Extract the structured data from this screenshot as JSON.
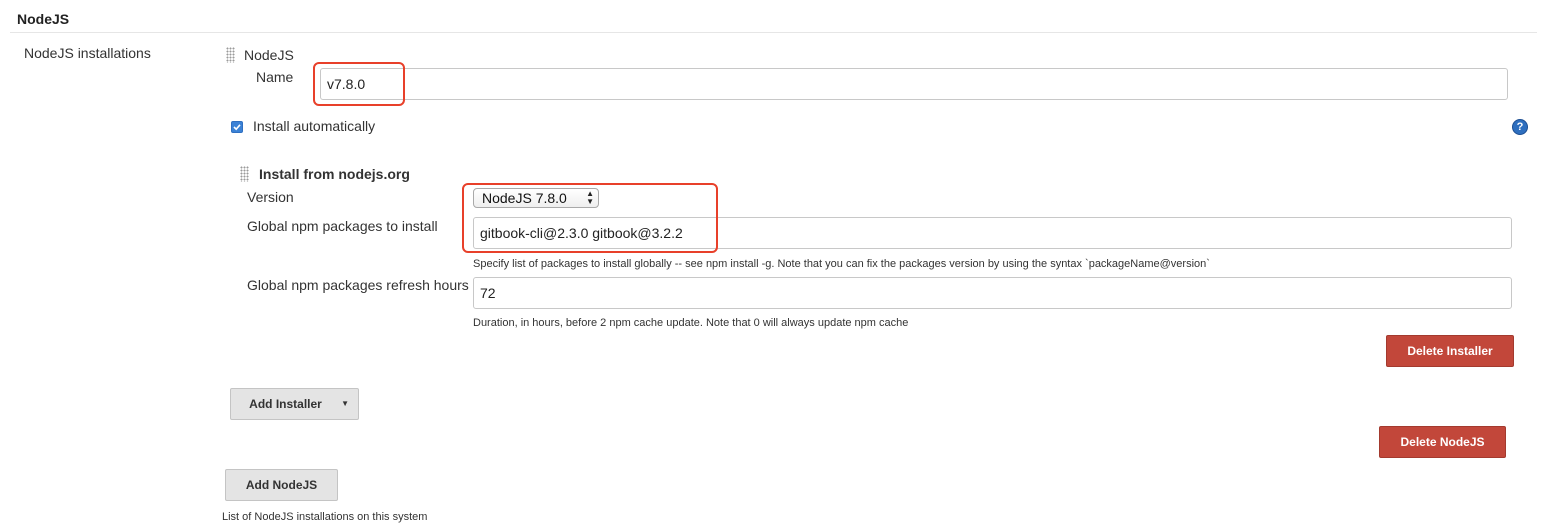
{
  "section": {
    "title": "NodeJS",
    "installations_label": "NodeJS installations"
  },
  "nodejs": {
    "header": "NodeJS",
    "name_label": "Name",
    "name_value": "v7.8.0",
    "install_automatically_label": "Install automatically",
    "install_automatically_checked": true
  },
  "installer": {
    "header": "Install from nodejs.org",
    "version_label": "Version",
    "version_selected": "NodeJS 7.8.0",
    "packages_label": "Global npm packages to install",
    "packages_value": "gitbook-cli@2.3.0 gitbook@3.2.2",
    "packages_hint": "Specify list of packages to install globally -- see npm install -g. Note that you can fix the packages version by using the syntax `packageName@version`",
    "refresh_label": "Global npm packages refresh hours",
    "refresh_value": "72",
    "refresh_hint": "Duration, in hours, before 2 npm cache update. Note that 0 will always update npm cache",
    "delete_label": "Delete Installer"
  },
  "buttons": {
    "add_installer": "Add Installer",
    "add_installer_caret": "▼",
    "delete_nodejs": "Delete NodeJS",
    "add_nodejs": "Add NodeJS"
  },
  "footer_hint": "List of NodeJS installations on this system",
  "help_glyph": "?",
  "icons": {
    "help": "help-icon",
    "checkbox": "checkbox-checked-icon",
    "drag": "drag-handle-icon",
    "dropdown": "chevron-down-icon"
  },
  "colors": {
    "accent_blue": "#2e6fbf",
    "danger_red": "#c2473a",
    "highlight_orange": "#e8402a"
  }
}
